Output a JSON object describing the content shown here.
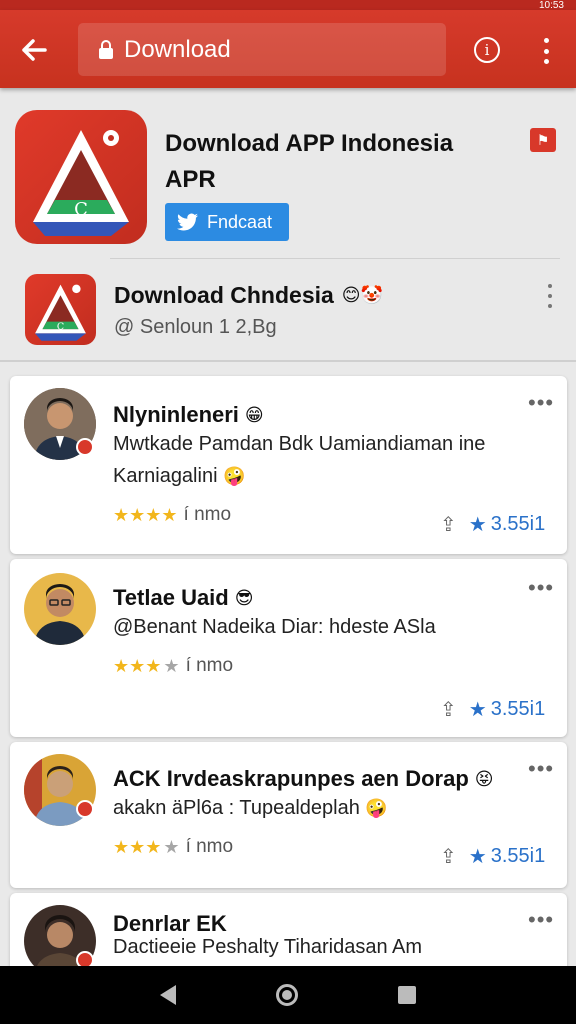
{
  "status_bar": {
    "time": "10:53"
  },
  "app_bar": {
    "search_label": "Download",
    "colors": {
      "bar": "#d63a2b"
    }
  },
  "header": {
    "title": "Download APP Indonesia APR",
    "share_button": "Fndcaat"
  },
  "app_row": {
    "title": "Download Chndesia",
    "subtitle": "@ Senloun 1 2,Bg"
  },
  "reviews": [
    {
      "name": "Nlyninleneri",
      "text": "Mwtkade Pamdan Bdk Uamiandiaman ine Karniagalini",
      "stars": 4,
      "meta": "í nmo",
      "rating": "3.55i1"
    },
    {
      "name": "Tetlae Uaid",
      "text": "@Benant Nadeika Diar: hdeste ASla",
      "stars": 3.5,
      "meta": "í nmo",
      "rating": "3.55i1"
    },
    {
      "name": "ACK Irvdeaskrapunpes aen Dorap",
      "text": "akakn äPl6a : Tupealdeplah",
      "stars": 3.5,
      "meta": "í nmo",
      "rating": "3.55i1"
    },
    {
      "name": "Denrlar EK",
      "text": "Dactieeie Peshalty Tiharidasan Am",
      "stars": 0,
      "meta": "",
      "rating": ""
    }
  ]
}
